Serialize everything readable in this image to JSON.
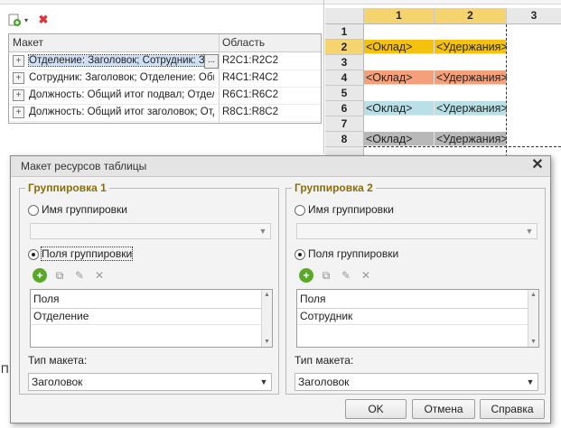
{
  "toolbar": {
    "add_icon": "add-plus-icon",
    "dropdown_icon": "chevron-down-icon",
    "delete_icon": "red-x-icon"
  },
  "left_table": {
    "col_layout": "Макет",
    "col_area": "Область",
    "rows": [
      {
        "layout": "Отделение: Заголовок; Сотрудник: Заголовок",
        "area": "R2C1:R2C2",
        "selected": true
      },
      {
        "layout": "Сотрудник: Заголовок; Отделение: Общий итог",
        "area": "R4C1:R4C2",
        "selected": false
      },
      {
        "layout": "Должность: Общий итог подвал; Отделение",
        "area": "R6C1:R6C2",
        "selected": false
      },
      {
        "layout": "Должность: Общий итог заголовок; Отделение",
        "area": "R8C1:R8C2",
        "selected": false
      }
    ],
    "ellipsis": "..."
  },
  "sheet": {
    "cols": [
      "1",
      "2",
      "3"
    ],
    "rows": [
      "1",
      "2",
      "3",
      "4",
      "5",
      "6",
      "7",
      "8"
    ],
    "cells": [
      {
        "row": "2",
        "a": "<Оклад>",
        "b": "<Удержания>",
        "color": "#f4c20d"
      },
      {
        "row": "4",
        "a": "<Оклад>",
        "b": "<Удержания>",
        "color": "#f4a07a"
      },
      {
        "row": "6",
        "a": "<Оклад>",
        "b": "<Удержания>",
        "color": "#b8e0e6"
      },
      {
        "row": "8",
        "a": "<Оклад>",
        "b": "<Удержания>",
        "color": "#b8b8b8"
      }
    ]
  },
  "dialog": {
    "title": "Макет ресурсов таблицы",
    "close_icon": "close-x-icon",
    "group1": {
      "title": "Группировка 1",
      "radio_name": "Имя группировки",
      "radio_fields": "Поля группировки",
      "fields_header": "Поля",
      "field_value": "Отделение",
      "layout_type_label": "Тип макета:",
      "layout_type_value": "Заголовок"
    },
    "group2": {
      "title": "Группировка 2",
      "radio_name": "Имя группировки",
      "radio_fields": "Поля группировки",
      "fields_header": "Поля",
      "field_value": "Сотрудник",
      "layout_type_label": "Тип макета:",
      "layout_type_value": "Заголовок"
    },
    "ok_label": "OK",
    "cancel_label": "Отмена",
    "help_label": "Справка"
  },
  "side_letter": "П"
}
